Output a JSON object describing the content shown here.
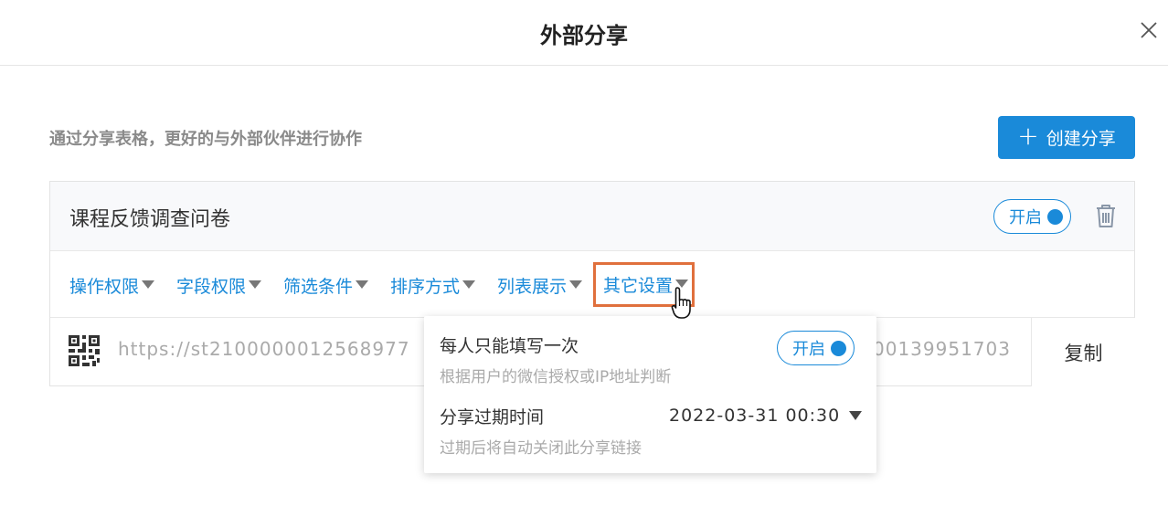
{
  "dialog": {
    "title": "外部分享",
    "intro": "通过分享表格，更好的与外部伙伴进行协作",
    "create_label": "创建分享",
    "create_icon": "plus-icon"
  },
  "share": {
    "name": "课程反馈调查问卷",
    "status": "开启",
    "tabs": [
      "操作权限",
      "字段权限",
      "筛选条件",
      "排序方式",
      "列表展示",
      "其它设置"
    ],
    "active_tab": "其它设置",
    "url_prefix": "https://st2100000012568977",
    "url_suffix": "00139951703",
    "copy_label": "复制"
  },
  "settings_popup": {
    "once": {
      "title": "每人只能填写一次",
      "desc": "根据用户的微信授权或IP地址判断",
      "status": "开启"
    },
    "expire": {
      "title": "分享过期时间",
      "desc": "过期后将自动关闭此分享链接",
      "value": "2022-03-31 00:30"
    }
  },
  "colors": {
    "accent": "#1a8ad9",
    "highlight": "#e0703d"
  }
}
